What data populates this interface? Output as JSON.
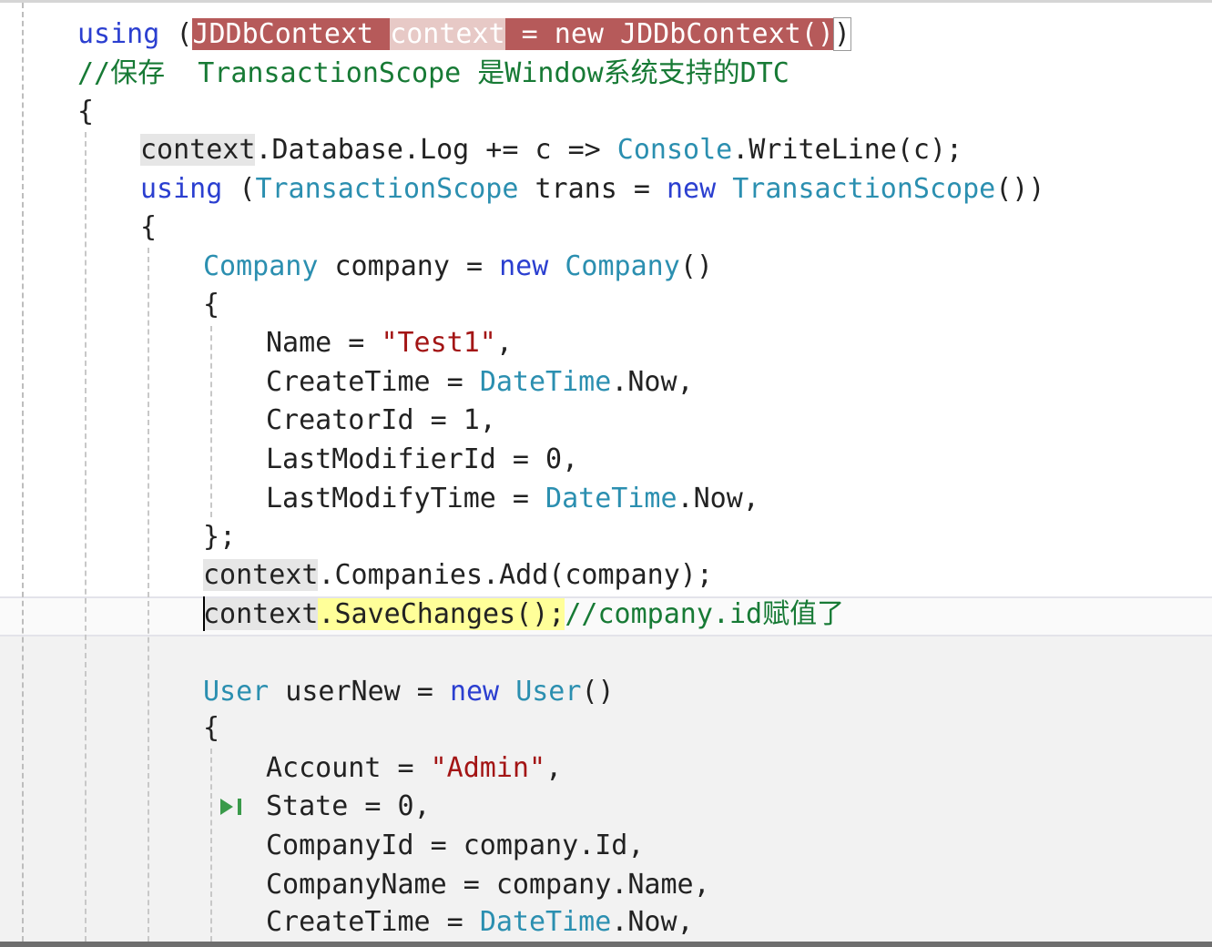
{
  "code": {
    "l1": [
      "using",
      " (",
      "JDDbContext ",
      "context",
      " = new JDDbContext()",
      ")"
    ],
    "l2": "//保存  TransactionScope 是Window系统支持的DTC",
    "l3": "{",
    "l4": [
      "context",
      ".Database.Log += c => ",
      "Console",
      ".WriteLine(c);"
    ],
    "l5": [
      "using",
      " (",
      "TransactionScope",
      " trans = ",
      "new",
      " ",
      "TransactionScope",
      "())"
    ],
    "l6": "{",
    "l7": [
      "Company",
      " company = ",
      "new",
      " ",
      "Company",
      "()"
    ],
    "l8": "{",
    "l9": [
      "Name = ",
      "\"Test1\"",
      ","
    ],
    "l10": [
      "CreateTime = ",
      "DateTime",
      ".Now,"
    ],
    "l11": "CreatorId = 1,",
    "l12": "LastModifierId = 0,",
    "l13": [
      "LastModifyTime = ",
      "DateTime",
      ".Now,"
    ],
    "l14": "};",
    "l15": [
      "context",
      ".Companies.Add(company);"
    ],
    "l16": [
      "context",
      ".SaveChanges();",
      "//company.id赋值了"
    ],
    "l17": [
      "User",
      " userNew = ",
      "new",
      " ",
      "User",
      "()"
    ],
    "l18": "{",
    "l19": [
      "Account = ",
      "\"Admin\"",
      ","
    ],
    "l20": "State = 0,",
    "l21": "CompanyId = company.Id,",
    "l22": "CompanyName = company.Name,",
    "l23": [
      "CreateTime = ",
      "DateTime",
      ".Now,"
    ]
  },
  "colors": {
    "keyword": "#2b3fd0",
    "type": "#2b8fb0",
    "comment": "#177a35",
    "string": "#a31515",
    "error_highlight": "#b65a5a",
    "reference_highlight": "#ffff99"
  },
  "icons": {
    "current_statement": "step-arrow-icon"
  }
}
